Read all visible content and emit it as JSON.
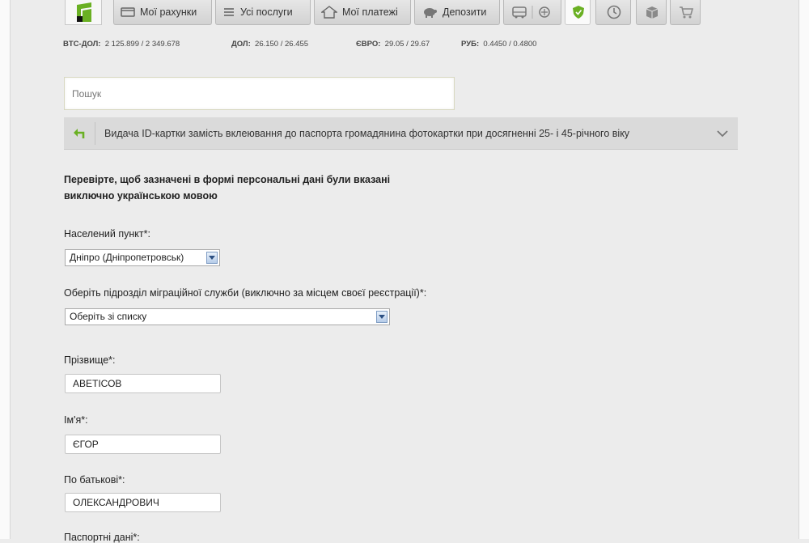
{
  "nav": {
    "tabs": [
      {
        "label": "Мої рахунки",
        "icon": "wallet-icon"
      },
      {
        "label": "Усі послуги",
        "icon": "list-icon"
      },
      {
        "label": "Мої платежі",
        "icon": "house-icon"
      },
      {
        "label": "Депозити",
        "icon": "piggy-bank-icon"
      },
      {
        "label": "",
        "icon": "transport-icon"
      },
      {
        "label": "",
        "icon": "shield-icon"
      },
      {
        "label": "",
        "icon": "clock-icon"
      },
      {
        "label": "",
        "icon": "box-icon"
      },
      {
        "label": "",
        "icon": "cart-icon"
      }
    ],
    "accent": "#6ab023"
  },
  "rates": [
    {
      "label": "BTC-ДОЛ:",
      "value": "2 125.899 / 2 349.678"
    },
    {
      "label": "ДОЛ:",
      "value": "26.150 / 26.455"
    },
    {
      "label": "ЄВРО:",
      "value": "29.05 / 29.67"
    },
    {
      "label": "РУБ:",
      "value": "0.4450 / 0.4800"
    }
  ],
  "search": {
    "placeholder": "Пошук"
  },
  "topic": {
    "text": "Видача ID-картки замість вклеювання до паспорта громадянина фотокартки при досягненні 25- і 45-річного віку",
    "back_icon": "back-arrow-icon",
    "expand_icon": "chevron-down-icon"
  },
  "notice": {
    "line1": "Перевірте, щоб зазначені в формі персональні дані були вказані",
    "line2": "виключно українською мовою"
  },
  "form": {
    "city": {
      "label": "Населений пункт*:",
      "value": "Дніпро (Дніпропетровськ)"
    },
    "office": {
      "label": "Оберіть підрозділ міграційної служби (виключно за місцем своєї реєстрації)*:",
      "value": "Оберіть зі списку"
    },
    "surname": {
      "label": "Прізвище*:",
      "value": "АВЕТІСОВ"
    },
    "name": {
      "label": "Ім'я*:",
      "value": "ЄГОР"
    },
    "patronymic": {
      "label": "По батькові*:",
      "value": "ОЛЕКСАНДРОВИЧ"
    },
    "next_label": "Паспортні дані*:"
  }
}
